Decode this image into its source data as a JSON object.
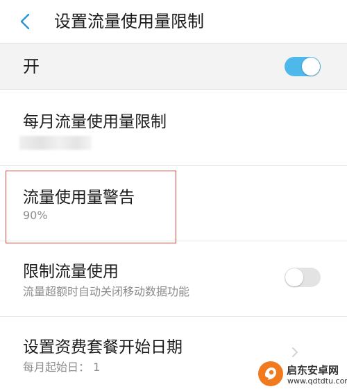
{
  "header": {
    "title": "设置流量使用量限制",
    "back_icon": "chevron-left-icon"
  },
  "master_switch": {
    "label": "开",
    "state": "on"
  },
  "settings": [
    {
      "title": "每月流量使用量限制",
      "subtitle_obscured": true
    },
    {
      "title": "流量使用量警告",
      "subtitle": "90%",
      "highlighted": true
    },
    {
      "title": "限制流量使用",
      "subtitle": "流量超额时自动关闭移动数据功能",
      "toggle_state": "off"
    },
    {
      "title": "设置资费套餐开始日期",
      "subtitle": "每月起始日： 1"
    }
  ],
  "watermark": {
    "name": "启东安卓网",
    "url": "www.qdtdtu.com"
  },
  "colors": {
    "accent": "#4fb8ea",
    "back_icon": "#2a94d4",
    "highlight_border": "#e5443b",
    "watermark_logo": "#f07a1d"
  }
}
